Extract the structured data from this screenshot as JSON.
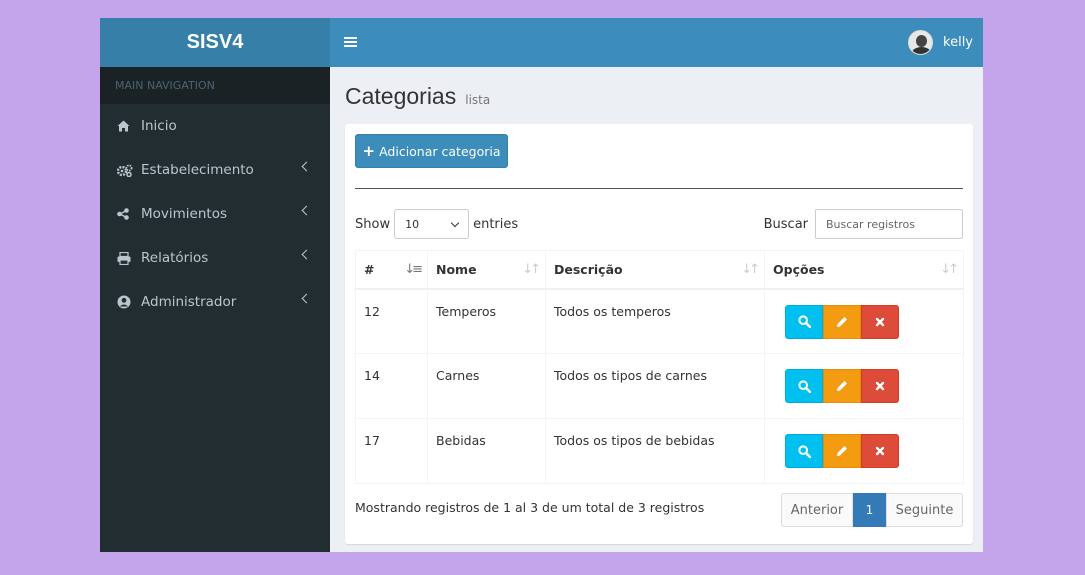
{
  "app": {
    "logo": "SISV4",
    "user": "kelly"
  },
  "sidebar": {
    "header": "MAIN NAVIGATION",
    "items": [
      {
        "label": "Inicio",
        "icon": "home-icon",
        "has_submenu": false
      },
      {
        "label": "Estabelecimento",
        "icon": "cogs-icon",
        "has_submenu": true
      },
      {
        "label": "Movimientos",
        "icon": "share-icon",
        "has_submenu": true
      },
      {
        "label": "Relatórios",
        "icon": "print-icon",
        "has_submenu": true
      },
      {
        "label": "Administrador",
        "icon": "user-circle-icon",
        "has_submenu": true
      }
    ]
  },
  "page": {
    "title": "Categorias",
    "subtitle": "lista"
  },
  "toolbar": {
    "add_label": "Adicionar categoria"
  },
  "table_controls": {
    "show_label": "Show",
    "entries_value": "10",
    "entries_label": "entries",
    "search_label": "Buscar",
    "search_placeholder": "Buscar registros"
  },
  "table": {
    "columns": [
      "#",
      "Nome",
      "Descrição",
      "Opções"
    ],
    "rows": [
      {
        "id": "12",
        "nome": "Temperos",
        "descricao": "Todos os temperos"
      },
      {
        "id": "14",
        "nome": "Carnes",
        "descricao": "Todos os tipos de carnes"
      },
      {
        "id": "17",
        "nome": "Bebidas",
        "descricao": "Todos os tipos de bebidas"
      }
    ]
  },
  "footer": {
    "info": "Mostrando registros de 1 al 3 de um total de 3 registros",
    "prev": "Anterior",
    "current_page": "1",
    "next": "Seguinte"
  },
  "colors": {
    "header": "#3c8dbc",
    "logo_bg": "#367fa9",
    "sidebar": "#222d32",
    "view": "#00c0ef",
    "edit": "#f39c12",
    "delete": "#dd4b39",
    "page_bg": "#c4a5ec"
  }
}
